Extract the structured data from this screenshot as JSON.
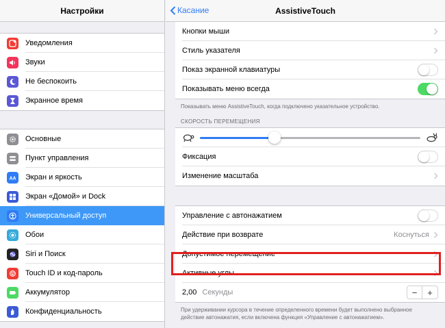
{
  "left": {
    "title": "Настройки",
    "group1": [
      {
        "label": "Уведомления",
        "icon": "notifications-icon",
        "color": "#f23b34"
      },
      {
        "label": "Звуки",
        "icon": "sounds-icon",
        "color": "#f2355c"
      },
      {
        "label": "Не беспокоить",
        "icon": "moon-icon",
        "color": "#5a58d6"
      },
      {
        "label": "Экранное время",
        "icon": "hourglass-icon",
        "color": "#5a58d6"
      }
    ],
    "group2": [
      {
        "label": "Основные",
        "icon": "gear-icon",
        "color": "#8e8e93"
      },
      {
        "label": "Пункт управления",
        "icon": "control-center-icon",
        "color": "#8e8e93"
      },
      {
        "label": "Экран и яркость",
        "icon": "display-icon",
        "color": "#2f7cf6"
      },
      {
        "label": "Экран «Домой» и Dock",
        "icon": "home-screen-icon",
        "color": "#3b5bd6"
      },
      {
        "label": "Универсальный доступ",
        "icon": "accessibility-icon",
        "color": "#2f7cf6"
      },
      {
        "label": "Обои",
        "icon": "wallpaper-icon",
        "color": "#36aadc"
      },
      {
        "label": "Siri и Поиск",
        "icon": "siri-icon",
        "color": "#222222"
      },
      {
        "label": "Touch ID и код-пароль",
        "icon": "fingerprint-icon",
        "color": "#f23b34"
      },
      {
        "label": "Аккумулятор",
        "icon": "battery-icon",
        "color": "#4cd964"
      },
      {
        "label": "Конфиденциальность",
        "icon": "privacy-hand-icon",
        "color": "#3b5bd6"
      }
    ],
    "selected": "Универсальный доступ"
  },
  "nav": {
    "back": "Касание",
    "title": "AssistiveTouch"
  },
  "group_a": [
    {
      "label": "Кнопки мыши",
      "type": "chevron"
    },
    {
      "label": "Стиль указателя",
      "type": "chevron"
    },
    {
      "label": "Показ экранной клавиатуры",
      "type": "toggle",
      "on": false
    },
    {
      "label": "Показывать меню всегда",
      "type": "toggle",
      "on": true
    }
  ],
  "footnote_a": "Показывать меню AssistiveTouch, когда подключено указательное устройство.",
  "speed_section": "СКОРОСТЬ ПЕРЕМЕЩЕНИЯ",
  "speed_slider": {
    "value": 0.34
  },
  "group_b": [
    {
      "label": "Фиксация",
      "type": "toggle",
      "on": false
    },
    {
      "label": "Изменение масштаба",
      "type": "chevron"
    }
  ],
  "group_c": [
    {
      "label": "Управление с автонажатием",
      "type": "toggle",
      "on": false
    },
    {
      "label": "Действие при возврате",
      "type": "chevron",
      "value": "Коснуться"
    },
    {
      "label": "Допустимое перемещение",
      "type": "chevron"
    },
    {
      "label": "Активные углы",
      "type": "chevron"
    }
  ],
  "stepper": {
    "value": "2,00",
    "unit": "Секунды",
    "minus": "−",
    "plus": "+"
  },
  "footnote_c": "При удерживании курсора в течение определенного времени будет выполнено выбранное действие автонажатия, если включена функция «Управление с автонажатием».",
  "colors": {
    "accent": "#2f7cf6",
    "selected_bg": "#3e98f7",
    "toggle_on": "#4cd964",
    "highlight": "#e0201f"
  }
}
